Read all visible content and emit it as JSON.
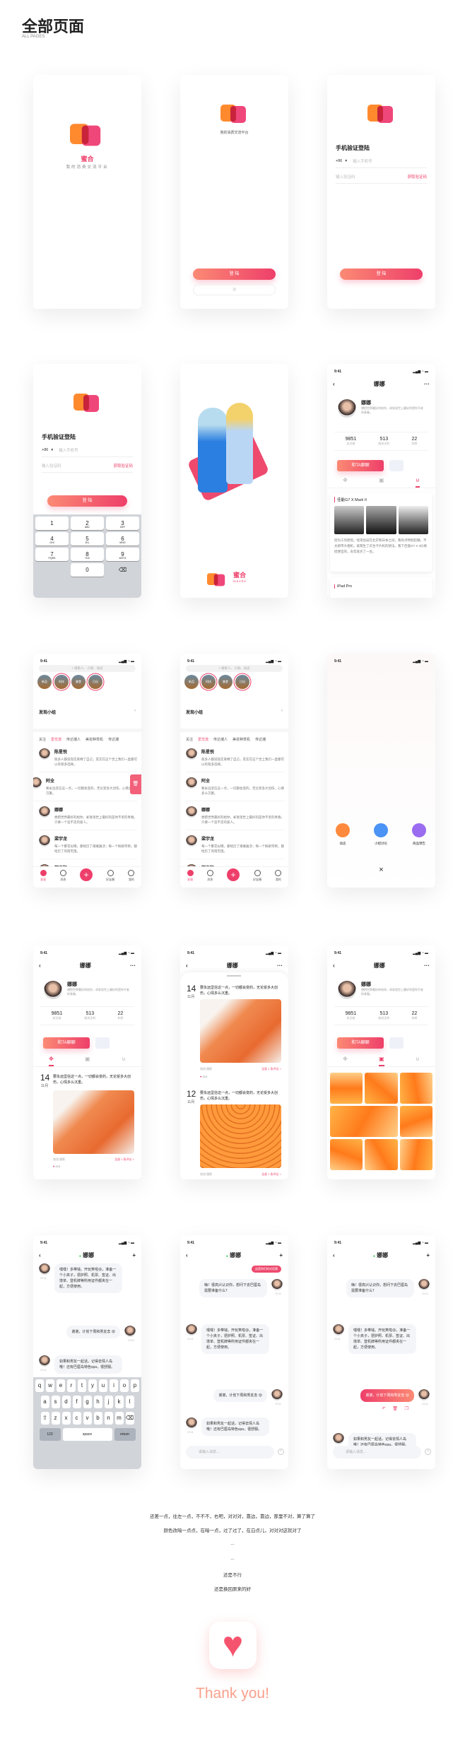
{
  "header": {
    "title": "全部页面",
    "subtitle": "ALL PAGES"
  },
  "colors": {
    "accent": "#ee3f6a",
    "orange": "#ff8a2e",
    "gradient_start": "#fb8a74",
    "thank_you": "#f9a08c"
  },
  "auth": {
    "brand": "蜜合",
    "brand_en": "meehe",
    "slogan": "我的消费交流平台",
    "login_button": "登 陆",
    "title": "手机验证登陆",
    "country_code": "+86",
    "phone_placeholder": "输入手机号",
    "code_placeholder": "输入验证码",
    "get_code": "获取验证码",
    "keys": [
      {
        "n": "1",
        "l": ""
      },
      {
        "n": "2",
        "l": "ABC"
      },
      {
        "n": "3",
        "l": "DEF"
      },
      {
        "n": "4",
        "l": "GHI"
      },
      {
        "n": "5",
        "l": "JKL"
      },
      {
        "n": "6",
        "l": "MNO"
      },
      {
        "n": "7",
        "l": "PQRS"
      },
      {
        "n": "8",
        "l": "TUV"
      },
      {
        "n": "9",
        "l": "WXYZ"
      },
      {
        "n": "",
        "l": ""
      },
      {
        "n": "0",
        "l": ""
      },
      {
        "n": "⌫",
        "l": ""
      }
    ]
  },
  "status": {
    "time": "9:41"
  },
  "profile": {
    "title": "娜娜",
    "name": "娜娜",
    "bio": "想把世界最好的给你，却发现世上最好的是你不老的青春。",
    "stats": [
      {
        "value": "9851",
        "label": "关注她"
      },
      {
        "value": "513",
        "label": "她关注的"
      },
      {
        "value": "22",
        "label": "年龄"
      }
    ],
    "chat_button": "和TA聊聊",
    "goods": [
      {
        "title": "佳能G7 X Mark II",
        "text": "因为工作原因，经常往返在北京和日本之间，我有点特别犯懒，不太想带大相机，就萌生了买台卡片机的想法，看下佳能G7 X II价格挺便宜的，去年就买了一台。"
      },
      {
        "title": "iPad Pro"
      }
    ],
    "posts": [
      {
        "day": "14",
        "month": "11月",
        "text": "要永远坚信这一点，一切都会变的，无论受多大创伤，心情多么沉重。",
        "tags": "旅游  摄影",
        "comments": "全部 1 条评论 >",
        "likes": "413"
      },
      {
        "day": "12",
        "month": "11月",
        "text": "要永远坚信这一点，一切都会变的，无论受多大创伤，心情多么沉重。",
        "tags": "旅游  摄影",
        "comments": "全部 1 条评论 >"
      }
    ]
  },
  "feed": {
    "search_placeholder": "搜索人、小组、动态",
    "circles": [
      "新品",
      "科技",
      "美食",
      "日出"
    ],
    "section": "发现小组",
    "tabs": [
      "关注",
      "爱交流",
      "传达潮人",
      "美妆种草机",
      "传达潮"
    ],
    "users": [
      {
        "name": "陈星悦",
        "text": "很多人都说现实束缚了自己，其实在这个世上我们一直都可以有很多选择。"
      },
      {
        "name": "阿全",
        "text": "要永远坚信这一点，一切都会变的，无论受多大创伤，心情多么沉重。"
      },
      {
        "name": "娜娜",
        "text": "想把世界最好的给你，却发现世上最好的是你不老的青春。只要一个追不走的爱人。"
      },
      {
        "name": "梁宇龙",
        "text": "每一个繁花似锦，都经历了艰难跋涉；每一个鲜艳夺目，都经历了风雨无阻。"
      },
      {
        "name": "郭杰智",
        "text": ""
      }
    ],
    "nav": [
      "发现",
      "消息",
      "+",
      "好友圈",
      "我的"
    ]
  },
  "publish": {
    "options": [
      "动态",
      "小组讨论",
      "商品预告"
    ],
    "close": "×"
  },
  "chat": {
    "title": "娜娜",
    "tip": "这是你们的对话哦",
    "time": "23:41",
    "input_placeholder": "请输入消息...",
    "messages": [
      "嗨！很高兴认识你，想问下去巴厘岛需要准备什么？",
      "嘿嘿！多带钱。开玩笑啦😜，准备一个小夹子，把护照、机票、签证、出境单、登机牌等所用证件都夹在一起，方便使用。",
      "谢谢，计划下周和男友去 😜",
      "如果和男友一起话，记得去情人岛哦！还有巴厘岛特色spa，很舒服。"
    ],
    "keyboard": {
      "row1": "qwertyuiop",
      "row2": "asdfghjkl",
      "row3": "zxcvbnm",
      "num": "123",
      "space": "space",
      "return": "return"
    }
  },
  "footer": {
    "lines": [
      "还差一点，往左一点，不不不，右吧，对对对，靠边，靠边，那里不对，算了算了",
      "颜色改暗一点点，在暗一点，过了过了，在白点儿，对对对这就对了",
      "...",
      "...",
      "还是不行",
      "还是换回原来的好"
    ],
    "thanks": "Thank you!"
  }
}
